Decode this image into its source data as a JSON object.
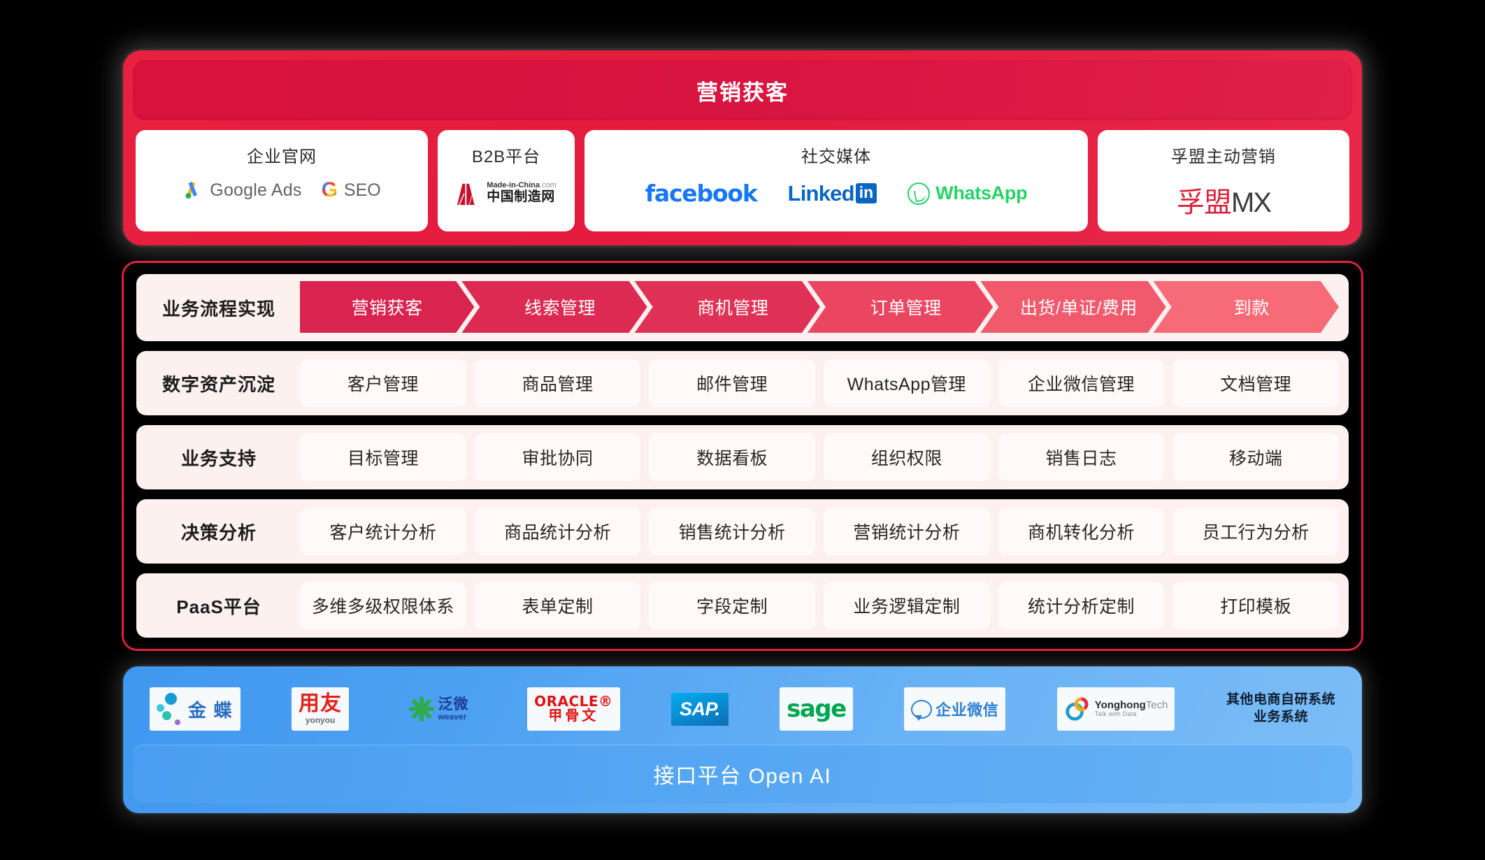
{
  "theme": {
    "page_bg": "#000000",
    "red_accent": "#e01b3c",
    "red_banner": "#d8123c",
    "blue_accent": "#4a9ef1",
    "row_bg": "#fdf1ef",
    "cell_bg": "#fffaf9"
  },
  "top": {
    "banner_title": "营销获客",
    "channels": [
      {
        "title": "企业官网",
        "logos": [
          {
            "name": "google-ads-logo",
            "text": "Google Ads"
          },
          {
            "name": "seo-logo",
            "g": "G",
            "text": "SEO"
          }
        ]
      },
      {
        "title": "B2B平台",
        "logos": [
          {
            "name": "made-in-china-logo",
            "en": "Made-in-China",
            "dotcom": ".com",
            "cn": "中国制造网"
          }
        ]
      },
      {
        "title": "社交媒体",
        "logos": [
          {
            "name": "facebook-logo",
            "text": "facebook"
          },
          {
            "name": "linkedin-logo",
            "word": "Linked",
            "box": "in"
          },
          {
            "name": "whatsapp-logo",
            "text": "WhatsApp"
          }
        ]
      },
      {
        "title": "孚盟主动营销",
        "logos": [
          {
            "name": "fumeng-mx-logo",
            "cn": "孚盟",
            "en": "MX"
          }
        ]
      }
    ]
  },
  "matrix": {
    "rows": [
      {
        "label": "业务流程实现",
        "type": "flow",
        "cells": [
          "营销获客",
          "线索管理",
          "商机管理",
          "订单管理",
          "出货/单证/费用",
          "到款"
        ]
      },
      {
        "label": "数字资产沉淀",
        "type": "plain",
        "cells": [
          "客户管理",
          "商品管理",
          "邮件管理",
          "WhatsApp管理",
          "企业微信管理",
          "文档管理"
        ]
      },
      {
        "label": "业务支持",
        "type": "plain",
        "cells": [
          "目标管理",
          "审批协同",
          "数据看板",
          "组织权限",
          "销售日志",
          "移动端"
        ]
      },
      {
        "label": "决策分析",
        "type": "plain",
        "cells": [
          "客户统计分析",
          "商品统计分析",
          "销售统计分析",
          "营销统计分析",
          "商机转化分析",
          "员工行为分析"
        ]
      },
      {
        "label": "PaaS平台",
        "type": "plain",
        "cells": [
          "多维多级权限体系",
          "表单定制",
          "字段定制",
          "业务逻辑定制",
          "统计分析定制",
          "打印模板"
        ]
      }
    ]
  },
  "bottom": {
    "partners": [
      {
        "name": "kingdee-logo",
        "cn": "金 蝶"
      },
      {
        "name": "yonyou-logo",
        "cn": "用友",
        "en": "yonyou"
      },
      {
        "name": "weaver-logo",
        "cn": "泛微",
        "en": "weaver"
      },
      {
        "name": "oracle-logo",
        "en": "ORACLE®",
        "cn": "甲骨文"
      },
      {
        "name": "sap-logo",
        "text": "SAP."
      },
      {
        "name": "sage-logo",
        "text": "sage"
      },
      {
        "name": "wecom-logo",
        "cn": "企业微信"
      },
      {
        "name": "yonghong-tech-logo",
        "main": "Yonghong",
        "tech": "Tech",
        "sub": "Talk with Data"
      }
    ],
    "note_line1": "其他电商自研系统",
    "note_line2": "业务系统",
    "banner_title": "接口平台 Open AI"
  }
}
